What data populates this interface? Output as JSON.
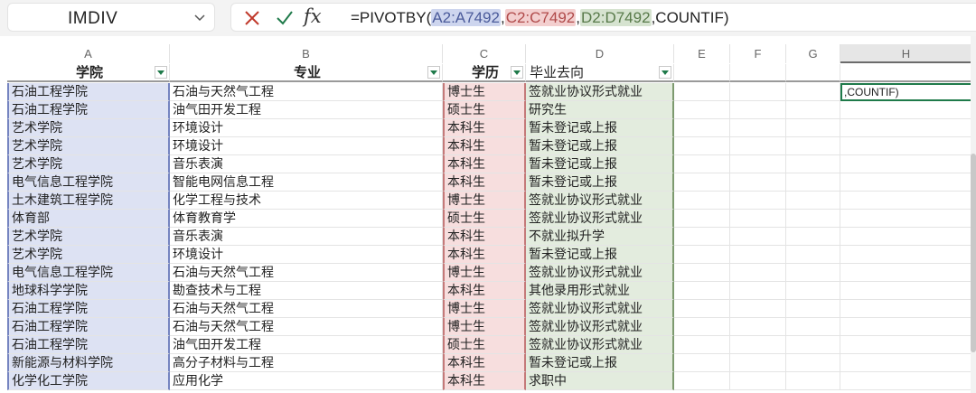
{
  "name_box": {
    "value": "IMDIV"
  },
  "formula_bar": {
    "cancel_icon": "x-icon",
    "enter_icon": "check-icon",
    "insert_function_label": "fx",
    "prefix": "=PIVOTBY(",
    "ref1": "A2:A7492",
    "sep1": ",",
    "ref2": "C2:C7492",
    "sep2": ",",
    "ref3": "D2:D7492",
    "suffix": ",COUNTIF)"
  },
  "colors": {
    "ref_a_fill": "#dde2f3",
    "ref_c_fill": "#f7dede",
    "ref_d_fill": "#e3ecde",
    "active_border": "#1f7a4a"
  },
  "columns": [
    "A",
    "B",
    "C",
    "D",
    "E",
    "F",
    "G",
    "H"
  ],
  "header_row": {
    "a": "学院",
    "b": "专业",
    "c": "学历",
    "d": "毕业去向"
  },
  "editing_cell": {
    "text": ",COUNTIF)"
  },
  "rows": [
    [
      "石油工程学院",
      "石油与天然气工程",
      "博士生",
      "签就业协议形式就业"
    ],
    [
      "石油工程学院",
      "油气田开发工程",
      "硕士生",
      "研究生"
    ],
    [
      "艺术学院",
      "环境设计",
      "本科生",
      "暂未登记或上报"
    ],
    [
      "艺术学院",
      "环境设计",
      "本科生",
      "暂未登记或上报"
    ],
    [
      "艺术学院",
      "音乐表演",
      "本科生",
      "暂未登记或上报"
    ],
    [
      "电气信息工程学院",
      "智能电网信息工程",
      "本科生",
      "暂未登记或上报"
    ],
    [
      "土木建筑工程学院",
      "化学工程与技术",
      "博士生",
      "签就业协议形式就业"
    ],
    [
      "体育部",
      "体育教育学",
      "硕士生",
      "签就业协议形式就业"
    ],
    [
      "艺术学院",
      "音乐表演",
      "本科生",
      "不就业拟升学"
    ],
    [
      "艺术学院",
      "环境设计",
      "本科生",
      "暂未登记或上报"
    ],
    [
      "电气信息工程学院",
      "石油与天然气工程",
      "博士生",
      "签就业协议形式就业"
    ],
    [
      "地球科学学院",
      "勘查技术与工程",
      "本科生",
      "其他录用形式就业"
    ],
    [
      "石油工程学院",
      "石油与天然气工程",
      "博士生",
      "签就业协议形式就业"
    ],
    [
      "石油工程学院",
      "石油与天然气工程",
      "博士生",
      "签就业协议形式就业"
    ],
    [
      "石油工程学院",
      "油气田开发工程",
      "硕士生",
      "签就业协议形式就业"
    ],
    [
      "新能源与材料学院",
      "高分子材料与工程",
      "本科生",
      "暂未登记或上报"
    ],
    [
      "化学化工学院",
      "应用化学",
      "本科生",
      "求职中"
    ]
  ]
}
